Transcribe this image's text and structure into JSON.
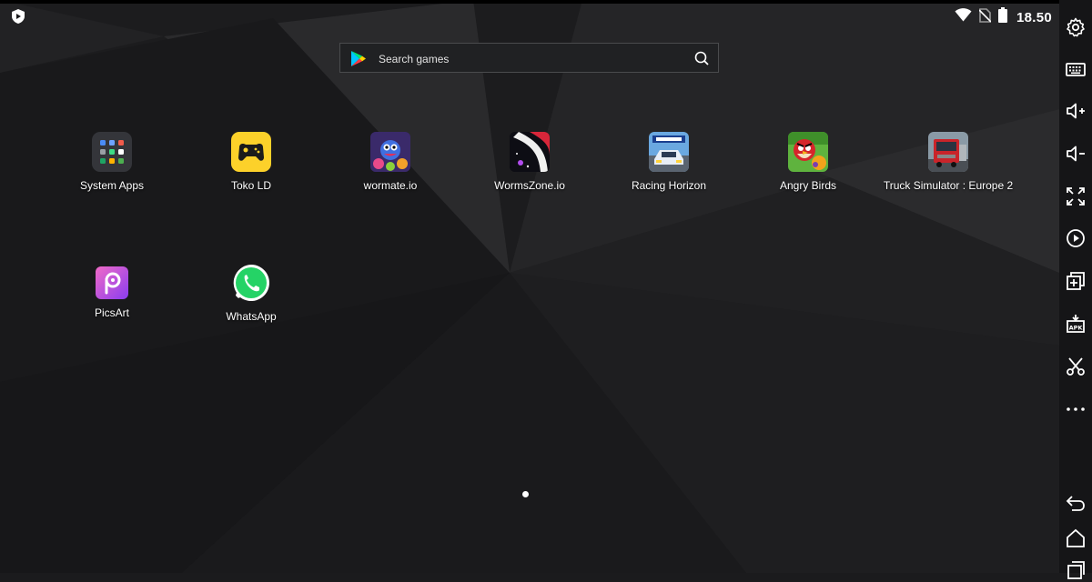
{
  "status_bar": {
    "time": "18.50"
  },
  "search": {
    "placeholder": "Search games"
  },
  "apps": [
    {
      "label": "System Apps"
    },
    {
      "label": "Toko LD"
    },
    {
      "label": "wormate.io"
    },
    {
      "label": "WormsZone.io"
    },
    {
      "label": "Racing Horizon"
    },
    {
      "label": "Angry Birds"
    },
    {
      "label": "Truck Simulator : Europe 2"
    },
    {
      "label": "PicsArt"
    },
    {
      "label": "WhatsApp"
    }
  ],
  "page_indicator": {
    "current": 1,
    "total": 1
  },
  "toolbar": {
    "items": [
      "gear-icon",
      "keyboard-icon",
      "volume-up-icon",
      "volume-down-icon",
      "fullscreen-icon",
      "record-icon",
      "multi-instance-icon",
      "apk-install-icon",
      "scissors-icon",
      "more-icon",
      "back-icon",
      "home-icon",
      "recents-icon"
    ]
  },
  "colors": {
    "background": "#1b1b1d",
    "toolbar": "#151517",
    "search_border": "#4a4b4d",
    "toko_ld": "#fcd12a",
    "whatsapp": "#25d366",
    "picsart": "#c636d4"
  }
}
